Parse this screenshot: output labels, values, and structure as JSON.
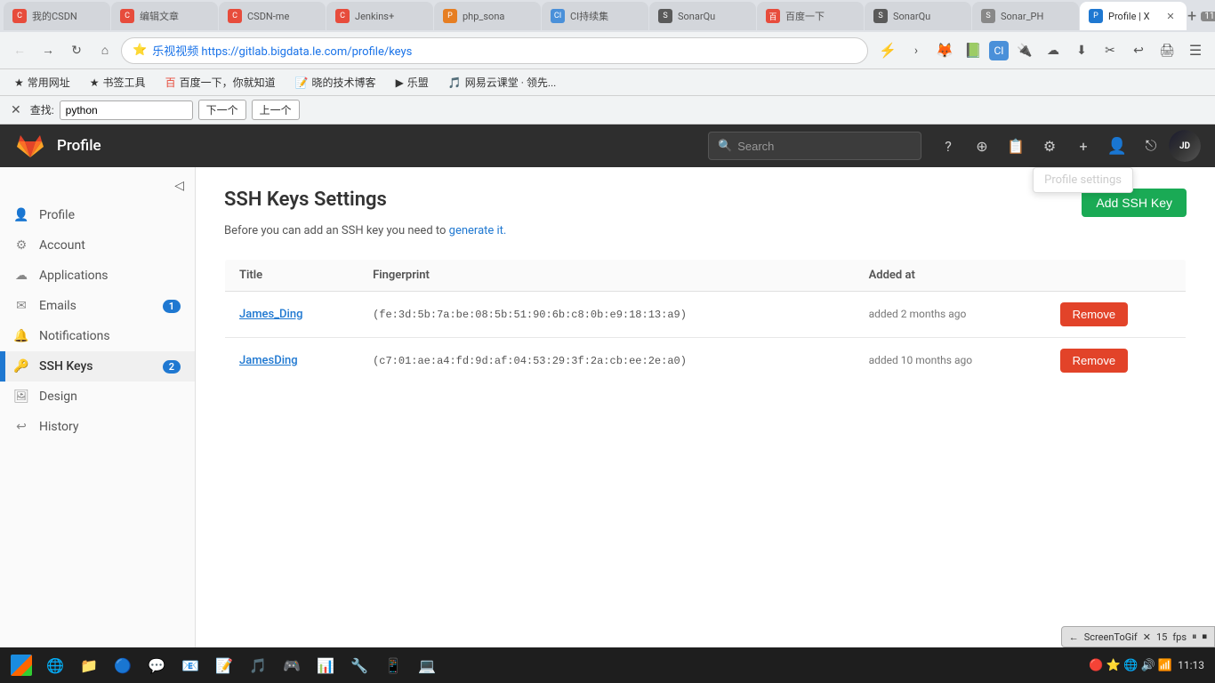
{
  "browser": {
    "tabs": [
      {
        "id": 1,
        "favicon": "C",
        "favicon_color": "#e74c3c",
        "title": "我的CSDN",
        "active": false
      },
      {
        "id": 2,
        "favicon": "C",
        "favicon_color": "#e74c3c",
        "title": "编辑文章",
        "active": false
      },
      {
        "id": 3,
        "favicon": "C",
        "favicon_color": "#e74c3c",
        "title": "CSDN-me",
        "active": false
      },
      {
        "id": 4,
        "favicon": "C",
        "favicon_color": "#e74c3c",
        "title": "Jenkins+",
        "active": false
      },
      {
        "id": 5,
        "favicon": "P",
        "favicon_color": "#e67e22",
        "title": "php_sona",
        "active": false
      },
      {
        "id": 6,
        "favicon": "CI",
        "favicon_color": "#4a90d9",
        "title": "CI持续集",
        "active": false
      },
      {
        "id": 7,
        "favicon": "S",
        "favicon_color": "#5a5a5a",
        "title": "SonarQu",
        "active": false
      },
      {
        "id": 8,
        "favicon": "百",
        "favicon_color": "#e74c3c",
        "title": "百度一下",
        "active": false
      },
      {
        "id": 9,
        "favicon": "S",
        "favicon_color": "#5a5a5a",
        "title": "SonarQu",
        "active": false
      },
      {
        "id": 10,
        "favicon": "S",
        "favicon_color": "#888",
        "title": "Sonar_PH",
        "active": false
      },
      {
        "id": 11,
        "favicon": "P",
        "favicon_color": "#1f78d1",
        "title": "Profile | X",
        "active": true
      }
    ],
    "tab_count": "11",
    "address": "https://gitlab.bigdata.le.com/profile/keys",
    "address_display": "乐视视频  https://gitlab.bigdata.le.com/profile/keys",
    "find_label": "查找:",
    "find_value": "python",
    "find_next": "下一个",
    "find_prev": "上一个"
  },
  "bookmarks": [
    {
      "label": "常用网址"
    },
    {
      "label": "书签工具"
    },
    {
      "label": "百度一下，你就知道"
    },
    {
      "label": "晓的技术博客"
    },
    {
      "label": "乐盟"
    },
    {
      "label": "网易云课堂 · 领先..."
    }
  ],
  "header": {
    "title": "Profile",
    "search_placeholder": "Search",
    "profile_tooltip": "Profile settings"
  },
  "sidebar": {
    "items": [
      {
        "id": "profile",
        "icon": "👤",
        "label": "Profile",
        "active": false,
        "badge": null
      },
      {
        "id": "account",
        "icon": "⚙",
        "label": "Account",
        "active": false,
        "badge": null
      },
      {
        "id": "applications",
        "icon": "☁",
        "label": "Applications",
        "active": false,
        "badge": null
      },
      {
        "id": "emails",
        "icon": "✉",
        "label": "Emails",
        "active": false,
        "badge": "1"
      },
      {
        "id": "notifications",
        "icon": "🔔",
        "label": "Notifications",
        "active": false,
        "badge": null
      },
      {
        "id": "ssh-keys",
        "icon": "🔑",
        "label": "SSH Keys",
        "active": true,
        "badge": "2"
      },
      {
        "id": "design",
        "icon": "🖼",
        "label": "Design",
        "active": false,
        "badge": null
      },
      {
        "id": "history",
        "icon": "↩",
        "label": "History",
        "active": false,
        "badge": null
      }
    ]
  },
  "main": {
    "page_title": "SSH Keys Settings",
    "page_subtitle_text": "Before you can add an SSH key you need to",
    "page_subtitle_link": "generate it.",
    "add_button_label": "Add SSH Key",
    "table": {
      "columns": [
        "Title",
        "Fingerprint",
        "Added at"
      ],
      "rows": [
        {
          "title": "James_Ding",
          "fingerprint": "(fe:3d:5b:7a:be:08:5b:51:90:6b:c8:0b:e9:18:13:a9)",
          "added_at": "added 2 months ago",
          "remove_label": "Remove"
        },
        {
          "title": "JamesDing",
          "fingerprint": "(c7:01:ae:a4:fd:9d:af:04:53:29:3f:2a:cb:ee:2e:a0)",
          "added_at": "added 10 months ago",
          "remove_label": "Remove"
        }
      ]
    }
  },
  "status_bar": {
    "url": "https://gitlab.bigdata.le.com/profile"
  },
  "taskbar": {
    "time": "11:13"
  },
  "screentogif": {
    "title": "ScreenToGif",
    "fps_label": "fps",
    "fps_value": "15"
  }
}
